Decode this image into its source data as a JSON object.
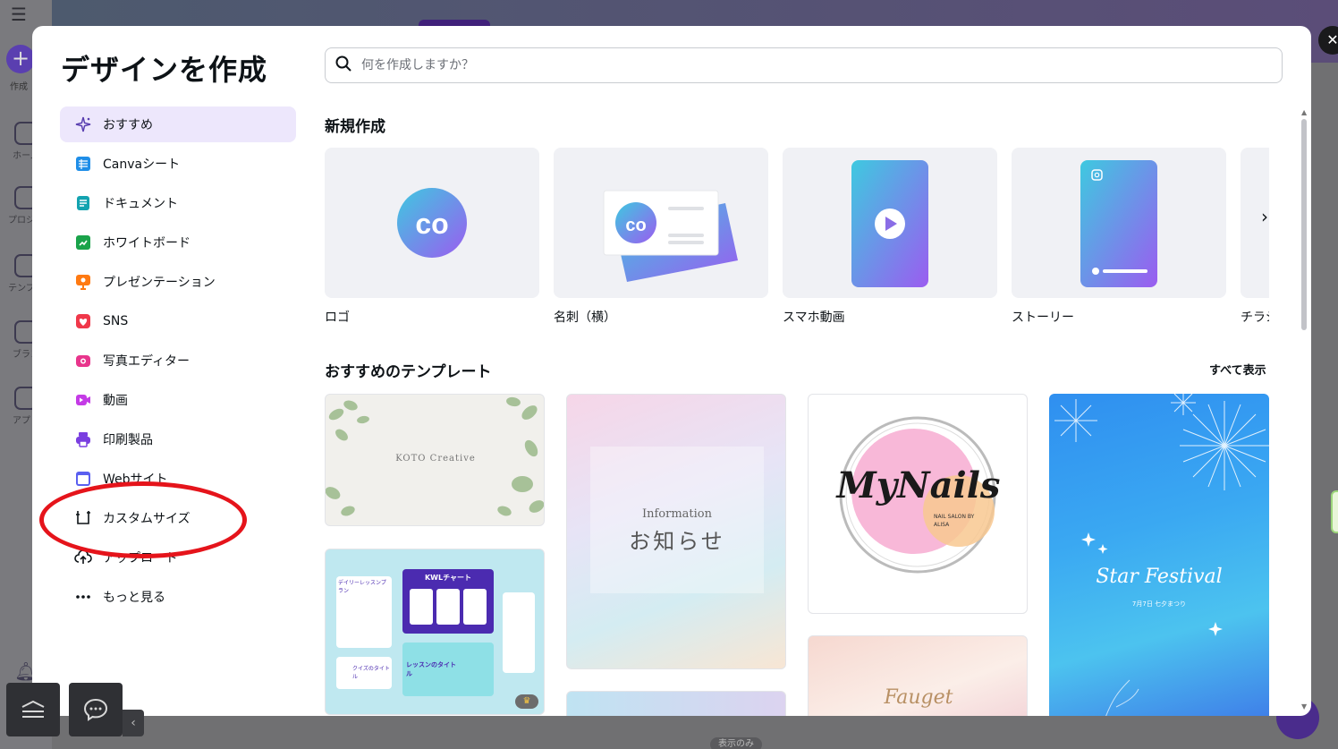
{
  "background": {
    "rail": {
      "create_label": "作成",
      "items": [
        "ホーム",
        "プロジェ",
        "テンプレ",
        "ブラン",
        "アプリ"
      ]
    },
    "badge": "表示のみ"
  },
  "modal": {
    "title": "デザインを作成",
    "close_icon": "close-icon",
    "search": {
      "placeholder": "何を作成しますか？"
    },
    "nav": [
      {
        "label": "おすすめ",
        "icon": "sparkle-icon",
        "color": "#7d2ae8",
        "active": true
      },
      {
        "label": "Canvaシート",
        "icon": "sheet-icon",
        "color": "#1f8ee8"
      },
      {
        "label": "ドキュメント",
        "icon": "document-icon",
        "color": "#13a3b0"
      },
      {
        "label": "ホワイトボード",
        "icon": "whiteboard-icon",
        "color": "#1aa34a"
      },
      {
        "label": "プレゼンテーション",
        "icon": "presentation-icon",
        "color": "#ff7a12"
      },
      {
        "label": "SNS",
        "icon": "heart-icon",
        "color": "#f0384a"
      },
      {
        "label": "写真エディター",
        "icon": "camera-icon",
        "color": "#e8358c"
      },
      {
        "label": "動画",
        "icon": "video-icon",
        "color": "#c43be6"
      },
      {
        "label": "印刷製品",
        "icon": "printer-icon",
        "color": "#7a3fe0"
      },
      {
        "label": "Webサイト",
        "icon": "website-icon",
        "color": "#5a5ff0"
      },
      {
        "label": "カスタムサイズ",
        "icon": "custom-size-icon",
        "color": "#0d1216"
      },
      {
        "label": "アップロード",
        "icon": "upload-icon",
        "color": "#0d1216"
      },
      {
        "label": "もっと見る",
        "icon": "more-icon",
        "color": "#0d1216"
      }
    ],
    "new_section_title": "新規作成",
    "design_types": [
      {
        "label": "ロゴ",
        "icon": "logo-icon"
      },
      {
        "label": "名刺（横）",
        "icon": "business-card-icon"
      },
      {
        "label": "スマホ動画",
        "icon": "phone-video-icon"
      },
      {
        "label": "ストーリー",
        "icon": "story-icon"
      },
      {
        "label": "チラシ",
        "icon": "flyer-icon"
      }
    ],
    "templates_title": "おすすめのテンプレート",
    "see_all": "すべて表示",
    "templates": [
      {
        "text": "KOTO Creative"
      },
      {
        "text": "KWLチャート",
        "sub": "デイリーレッスンプラン",
        "sub2": "クイズのタイトル",
        "sub3": "レッスンのタイトル"
      },
      {
        "text": "Information",
        "sub": "お知らせ"
      },
      {
        "text": "MyNails",
        "sub": "NAIL SALON BY ALISA"
      },
      {
        "text": "Star Festival",
        "sub": "7月7日 七夕まつり"
      },
      {
        "text": "Fauget"
      }
    ],
    "colors": {
      "accent": "#7d2ae8",
      "active_bg": "#ede7fc",
      "highlight": "#e5141b"
    }
  },
  "dock": {
    "menu_icon": "menu-icon",
    "chat_icon": "chat-icon",
    "collapse_icon": "chevron-left-icon"
  }
}
